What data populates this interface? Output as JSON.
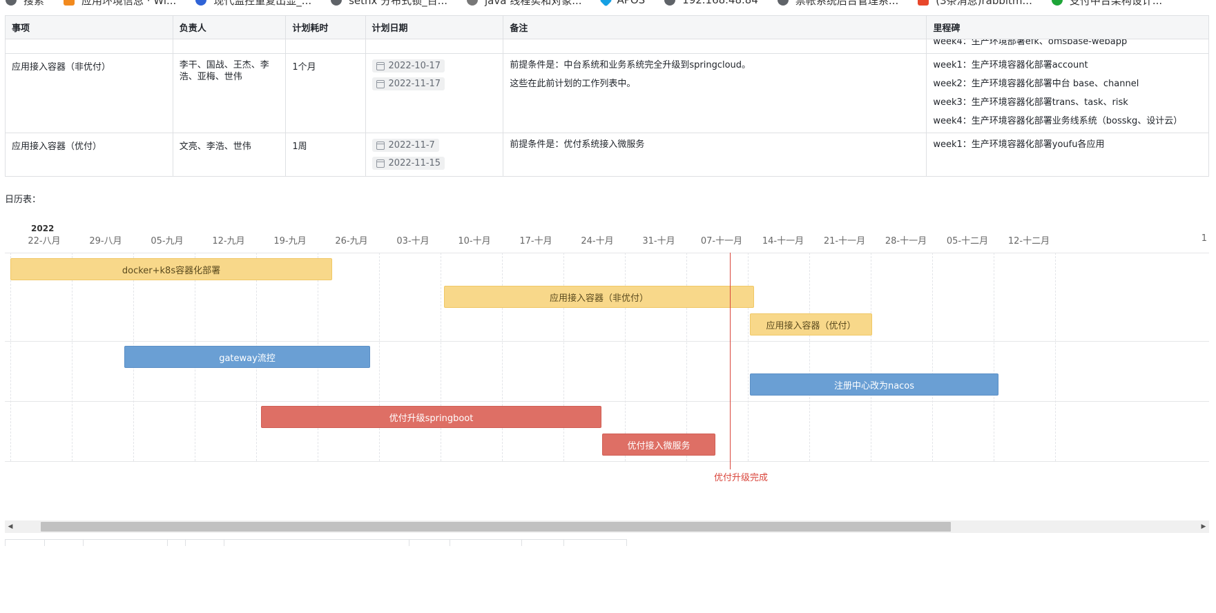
{
  "bookmarks": [
    {
      "label": "搜索",
      "icon": "globe-icon"
    },
    {
      "label": "应用环境信息 · Wi...",
      "icon": "gitlab-icon"
    },
    {
      "label": "现代监控重复出显_...",
      "icon": "baidu-icon"
    },
    {
      "label": "setnx 分布式锁_百...",
      "icon": "globe-icon"
    },
    {
      "label": "java 线程实和对象...",
      "icon": "search-icon"
    },
    {
      "label": "APOS",
      "icon": "apos-icon"
    },
    {
      "label": "192.168.48.84",
      "icon": "globe-icon"
    },
    {
      "label": "票帐系统后台管理系...",
      "icon": "globe-icon"
    },
    {
      "label": "(3条消息)rabbitm...",
      "icon": "csdn-icon"
    },
    {
      "label": "支付中台架构设计...",
      "icon": "wechat-icon"
    }
  ],
  "table": {
    "headers": [
      "事项",
      "负责人",
      "计划耗时",
      "计划日期",
      "备注",
      "里程碑"
    ],
    "partial_row_milestone": "week4：生产环境部署efk、omsbase-webapp",
    "rows": [
      {
        "item": "应用接入容器（非优付）",
        "owners": "李干、国战、王杰、李浩、亚梅、世伟",
        "duration": "1个月",
        "dates": [
          "2022-10-17",
          "2022-11-17"
        ],
        "notes": [
          "前提条件是：中台系统和业务系统完全升级到springcloud。",
          "这些在此前计划的工作列表中。"
        ],
        "milestones": [
          "week1：生产环境容器化部署account",
          "week2：生产环境容器化部署中台 base、channel",
          "week3：生产环境容器化部署trans、task、risk",
          "week4：生产环境容器化部署业务线系统（bosskg、设计云）"
        ]
      },
      {
        "item": "应用接入容器（优付）",
        "owners": "文亮、李浩、世伟",
        "duration": "1周",
        "dates": [
          "2022-11-7",
          "2022-11-15"
        ],
        "notes": [
          "前提条件是：优付系统接入微服务"
        ],
        "milestones": [
          "week1：生产环境容器化部署youfu各应用"
        ]
      }
    ]
  },
  "calendar_title": "日历表：",
  "gantt": {
    "year_label": "2022",
    "ticks": [
      "22-八月",
      "29-八月",
      "05-九月",
      "12-九月",
      "19-九月",
      "26-九月",
      "03-十月",
      "10-十月",
      "17-十月",
      "24-十月",
      "31-十月",
      "07-十一月",
      "14-十一月",
      "21-十一月",
      "28-十一月",
      "05-十二月",
      "12-十二月",
      "1"
    ],
    "today_label": "优付升级完成",
    "bars": [
      {
        "label": "docker+k8s容器化部署",
        "color": "yellow"
      },
      {
        "label": "应用接入容器（非优付）",
        "color": "yellow"
      },
      {
        "label": "应用接入容器（优付）",
        "color": "yellow"
      },
      {
        "label": "gateway流控",
        "color": "blue"
      },
      {
        "label": "注册中心改为nacos",
        "color": "blue"
      },
      {
        "label": "优付升级springboot",
        "color": "red"
      },
      {
        "label": "优付接入微服务",
        "color": "red"
      }
    ],
    "colors": {
      "yellow": "#f8d88a",
      "blue": "#6a9fd4",
      "red": "#de6f65",
      "today": "#d9453b"
    }
  }
}
